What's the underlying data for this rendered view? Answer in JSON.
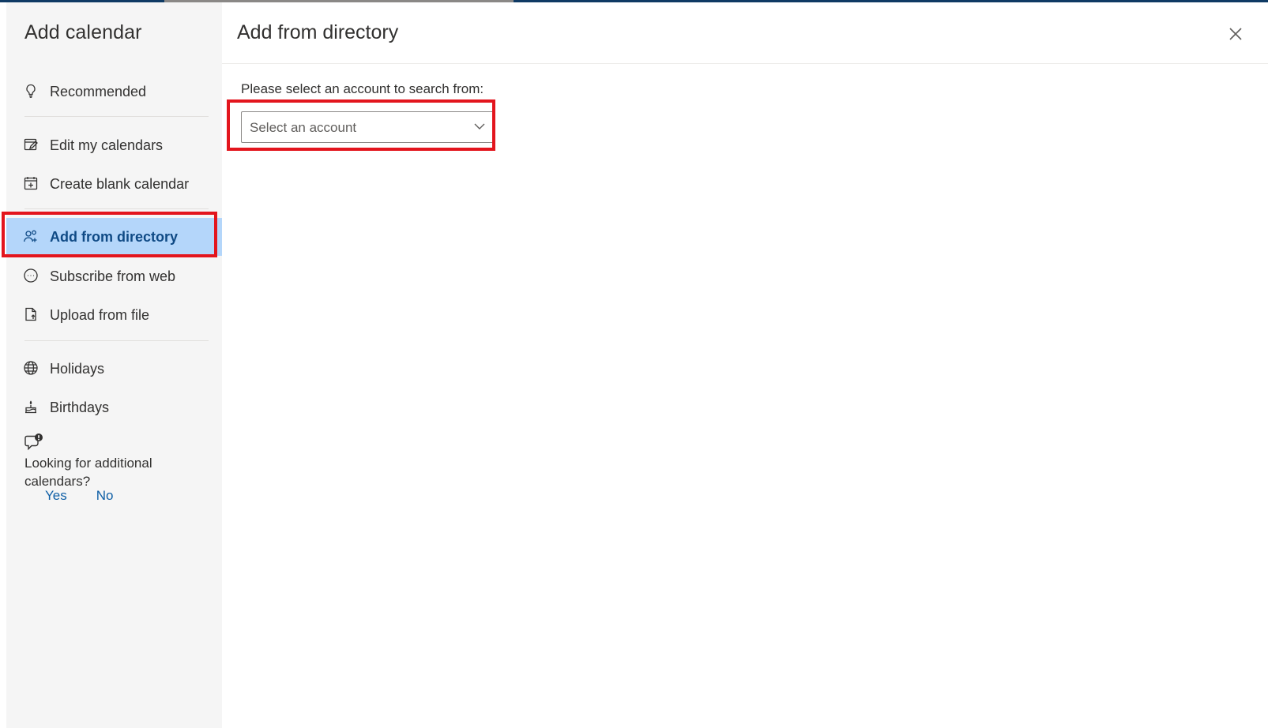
{
  "nav": {
    "title": "Add calendar",
    "items": [
      {
        "label": "Recommended",
        "icon": "lightbulb-icon"
      },
      {
        "label": "Edit my calendars",
        "icon": "edit-calendar-icon"
      },
      {
        "label": "Create blank calendar",
        "icon": "calendar-add-icon"
      },
      {
        "label": "Add from directory",
        "icon": "people-search-icon",
        "selected": true
      },
      {
        "label": "Subscribe from web",
        "icon": "web-subscribe-icon"
      },
      {
        "label": "Upload from file",
        "icon": "file-upload-icon"
      },
      {
        "label": "Holidays",
        "icon": "globe-icon"
      },
      {
        "label": "Birthdays",
        "icon": "cake-icon"
      }
    ],
    "feedback": {
      "icon": "feedback-alert-icon",
      "text": "Looking for additional calendars?",
      "yes": "Yes",
      "no": "No"
    }
  },
  "main": {
    "title": "Add from directory",
    "close_icon": "close-icon",
    "prompt": "Please select an account to search from:",
    "account_select": {
      "value": "Select an account",
      "icon": "chevron-down-icon"
    }
  },
  "colors": {
    "selected_bg": "#b4d6fa",
    "selected_text": "#0f4a85",
    "highlight": "#e3151d",
    "link": "#0f5fa6",
    "nav_bg": "#f5f5f5"
  }
}
